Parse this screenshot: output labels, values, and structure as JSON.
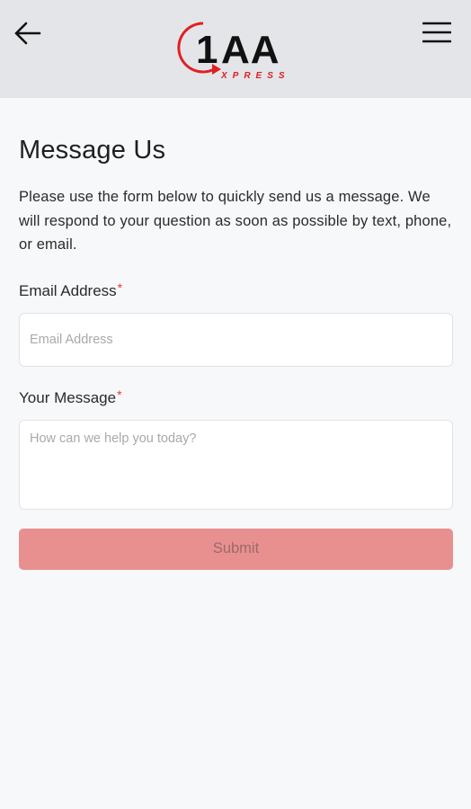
{
  "header": {
    "logo": {
      "main_text": "1AA",
      "sub_text": "XPRESS",
      "accent_color": "#e02020"
    },
    "back_icon": "arrow-left-icon",
    "menu_icon": "hamburger-menu-icon"
  },
  "page": {
    "title": "Message Us",
    "intro": "Please use the form below to quickly send us a message. We will respond to your question as soon as possible by text, phone, or email."
  },
  "form": {
    "email": {
      "label": "Email Address",
      "required_mark": "*",
      "placeholder": "Email Address",
      "value": ""
    },
    "message": {
      "label": "Your Message",
      "required_mark": "*",
      "placeholder": "How can we help you today?",
      "value": ""
    },
    "submit_label": "Submit",
    "submit_color": "#e89090"
  }
}
